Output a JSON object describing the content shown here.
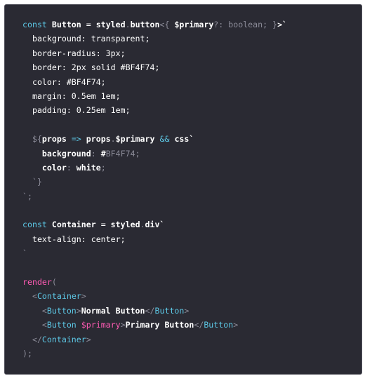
{
  "editor": {
    "language": "jsx",
    "cursor": {
      "line": 23,
      "after_token": 2
    },
    "lines": [
      [
        {
          "t": "keyword",
          "v": "const "
        },
        {
          "t": "ident",
          "v": "Button"
        },
        {
          "t": "plain",
          "v": " = "
        },
        {
          "t": "ident",
          "v": "styled"
        },
        {
          "t": "punct",
          "v": "."
        },
        {
          "t": "ident",
          "v": "button"
        },
        {
          "t": "punct",
          "v": "<{ "
        },
        {
          "t": "ident",
          "v": "$primary"
        },
        {
          "t": "punct",
          "v": "?: "
        },
        {
          "t": "type",
          "v": "boolean"
        },
        {
          "t": "punct",
          "v": "; }"
        },
        {
          "t": "ident",
          "v": ">`"
        }
      ],
      [
        {
          "t": "css",
          "v": "  background: transparent;"
        }
      ],
      [
        {
          "t": "css",
          "v": "  border-radius: 3px;"
        }
      ],
      [
        {
          "t": "css",
          "v": "  border: 2px solid #BF4F74;"
        }
      ],
      [
        {
          "t": "css",
          "v": "  color: #BF4F74;"
        }
      ],
      [
        {
          "t": "css",
          "v": "  margin: 0.5em 1em;"
        }
      ],
      [
        {
          "t": "css",
          "v": "  padding: 0.25em 1em;"
        }
      ],
      [],
      [
        {
          "t": "punct",
          "v": "  ${"
        },
        {
          "t": "ident",
          "v": "props "
        },
        {
          "t": "op",
          "v": "=> "
        },
        {
          "t": "ident",
          "v": "props"
        },
        {
          "t": "punct",
          "v": "."
        },
        {
          "t": "ident",
          "v": "$primary "
        },
        {
          "t": "op",
          "v": "&& "
        },
        {
          "t": "ident",
          "v": "css`"
        }
      ],
      [
        {
          "t": "ident",
          "v": "    background"
        },
        {
          "t": "punct",
          "v": ": "
        },
        {
          "t": "ident",
          "v": "#"
        },
        {
          "t": "type",
          "v": "BF4F74;"
        }
      ],
      [
        {
          "t": "ident",
          "v": "    color"
        },
        {
          "t": "punct",
          "v": ": "
        },
        {
          "t": "ident",
          "v": "white"
        },
        {
          "t": "punct",
          "v": ";"
        }
      ],
      [
        {
          "t": "punct",
          "v": "  `}"
        }
      ],
      [
        {
          "t": "punct",
          "v": "`;"
        }
      ],
      [],
      [
        {
          "t": "keyword",
          "v": "const "
        },
        {
          "t": "ident",
          "v": "Container"
        },
        {
          "t": "plain",
          "v": " = "
        },
        {
          "t": "ident",
          "v": "styled"
        },
        {
          "t": "punct",
          "v": "."
        },
        {
          "t": "ident",
          "v": "div`"
        }
      ],
      [
        {
          "t": "css",
          "v": "  text-align: center;"
        }
      ],
      [
        {
          "t": "punct",
          "v": "`"
        }
      ],
      [],
      [
        {
          "t": "func",
          "v": "render"
        },
        {
          "t": "punct",
          "v": "("
        }
      ],
      [
        {
          "t": "punct",
          "v": "  <"
        },
        {
          "t": "tag",
          "v": "Container"
        },
        {
          "t": "punct",
          "v": ">"
        }
      ],
      [
        {
          "t": "punct",
          "v": "    <"
        },
        {
          "t": "tag",
          "v": "Button"
        },
        {
          "t": "punct",
          "v": ">"
        },
        {
          "t": "text",
          "v": "Normal Button"
        },
        {
          "t": "punct",
          "v": "</"
        },
        {
          "t": "tag",
          "v": "Button"
        },
        {
          "t": "punct",
          "v": ">"
        }
      ],
      [
        {
          "t": "punct",
          "v": "    <"
        },
        {
          "t": "tag",
          "v": "Button "
        },
        {
          "t": "variable",
          "v": "$primary"
        },
        {
          "t": "punct",
          "v": ">"
        },
        {
          "t": "text",
          "v": "Primary Button"
        },
        {
          "t": "punct",
          "v": "</"
        },
        {
          "t": "tag",
          "v": "Button"
        },
        {
          "t": "punct",
          "v": ">"
        }
      ],
      [
        {
          "t": "punct",
          "v": "  </"
        },
        {
          "t": "tag",
          "v": "Container"
        },
        {
          "t": "punct",
          "v": ">"
        }
      ],
      [
        {
          "t": "punct",
          "v": ");"
        }
      ]
    ]
  },
  "colors": {
    "background": "#2a2a33",
    "keyword": "#5dc8e6",
    "tag": "#5dc8e6",
    "variable": "#ff5bb4",
    "function": "#ff5bb4",
    "punctuation": "#8b8b98",
    "text": "#ffffff"
  }
}
